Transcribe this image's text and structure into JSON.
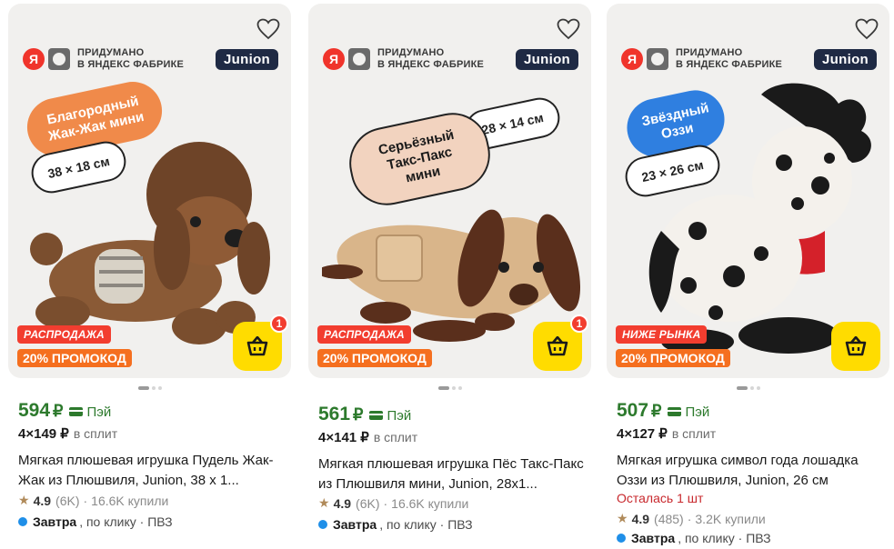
{
  "products": [
    {
      "brand_caption_1": "ПРИДУМАНО",
      "brand_caption_2": "В ЯНДЕКС ФАБРИКЕ",
      "brand_logo": "Junion",
      "ya_letter": "Я",
      "bubble_name": "Благородный Жак-Жак мини",
      "bubble_size": "38 × 18 см",
      "sale_tag": "РАСПРОДАЖА",
      "promo_tag": "20% ПРОМОКОД",
      "cart_count": "1",
      "price": "594",
      "currency": "₽",
      "pay_label": "Пэй",
      "split_amount": "4×149 ₽",
      "split_label": "в сплит",
      "title": "Мягкая плюшевая игрушка Пудель Жак-Жак из Плюшвиля, Junion, 38 х 1...",
      "stock": "",
      "rating": "4.9",
      "rating_count": "(6K)",
      "sep": "·",
      "bought": "16.6K купили",
      "delivery_when": "Завтра",
      "delivery_rest": ", по клику · ПВЗ",
      "bubble_color": "#f08a4a",
      "icons": [
        "heart-icon",
        "cart-icon",
        "star-icon"
      ]
    },
    {
      "brand_caption_1": "ПРИДУМАНО",
      "brand_caption_2": "В ЯНДЕКС ФАБРИКЕ",
      "brand_logo": "Junion",
      "ya_letter": "Я",
      "bubble_name": "Серьёзный Такс-Пакс мини",
      "bubble_size": "28 × 14 см",
      "sale_tag": "РАСПРОДАЖА",
      "promo_tag": "20% ПРОМОКОД",
      "cart_count": "1",
      "price": "561",
      "currency": "₽",
      "pay_label": "Пэй",
      "split_amount": "4×141 ₽",
      "split_label": "в сплит",
      "title": "Мягкая плюшевая игрушка Пёс Такс-Пакс из Плюшвиля мини, Junion, 28х1...",
      "stock": "",
      "rating": "4.9",
      "rating_count": "(6K)",
      "sep": "·",
      "bought": "16.6K купили",
      "delivery_when": "Завтра",
      "delivery_rest": ", по клику · ПВЗ",
      "bubble_color": "#f2d3bf",
      "icons": [
        "heart-icon",
        "cart-icon",
        "star-icon"
      ]
    },
    {
      "brand_caption_1": "ПРИДУМАНО",
      "brand_caption_2": "В ЯНДЕКС ФАБРИКЕ",
      "brand_logo": "Junion",
      "ya_letter": "Я",
      "bubble_name": "Звёздный Оззи",
      "bubble_size": "23 × 26 см",
      "sale_tag": "НИЖЕ РЫНКА",
      "promo_tag": "20% ПРОМОКОД",
      "cart_count": "",
      "price": "507",
      "currency": "₽",
      "pay_label": "Пэй",
      "split_amount": "4×127 ₽",
      "split_label": "в сплит",
      "title": "Мягкая игрушка символ года лошадка Оззи из Плюшвиля, Junion, 26 см",
      "stock": "Осталась 1 шт",
      "rating": "4.9",
      "rating_count": "(485)",
      "sep": "·",
      "bought": "3.2K купили",
      "delivery_when": "Завтра",
      "delivery_rest": ", по клику · ПВЗ",
      "bubble_color": "#2f7fe0",
      "icons": [
        "heart-icon",
        "cart-icon",
        "star-icon"
      ]
    }
  ],
  "colors": {
    "price_green": "#2d7a2d",
    "sale_red": "#f23d2f",
    "promo_orange": "#f56f1f",
    "cart_yellow": "#ffdc00",
    "stock_red": "#c8282d",
    "delivery_blue": "#1f8fe8"
  }
}
